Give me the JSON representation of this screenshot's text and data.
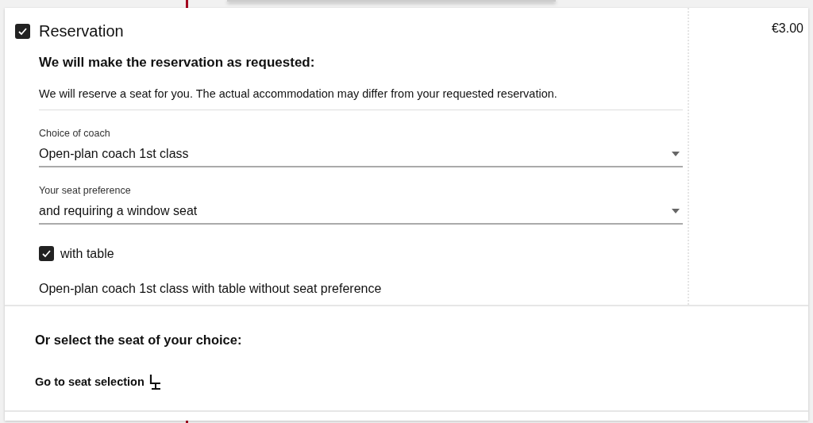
{
  "option": {
    "title": "Reservation",
    "checked": true,
    "price": "€3.00"
  },
  "heading": "We will make the reservation as requested:",
  "notice": "We will reserve a seat for you. The actual accommodation may differ from your requested reservation.",
  "selects": [
    {
      "label": "Choice of coach",
      "value": "Open-plan coach 1st class"
    },
    {
      "label": "Your seat preference",
      "value": "and requiring a window seat"
    }
  ],
  "table_option": {
    "label": "with table",
    "checked": true
  },
  "summary": "Open-plan coach 1st class with table without seat preference",
  "seat_section": {
    "heading": "Or select the seat of your choice:",
    "link": "Go to seat selection"
  }
}
